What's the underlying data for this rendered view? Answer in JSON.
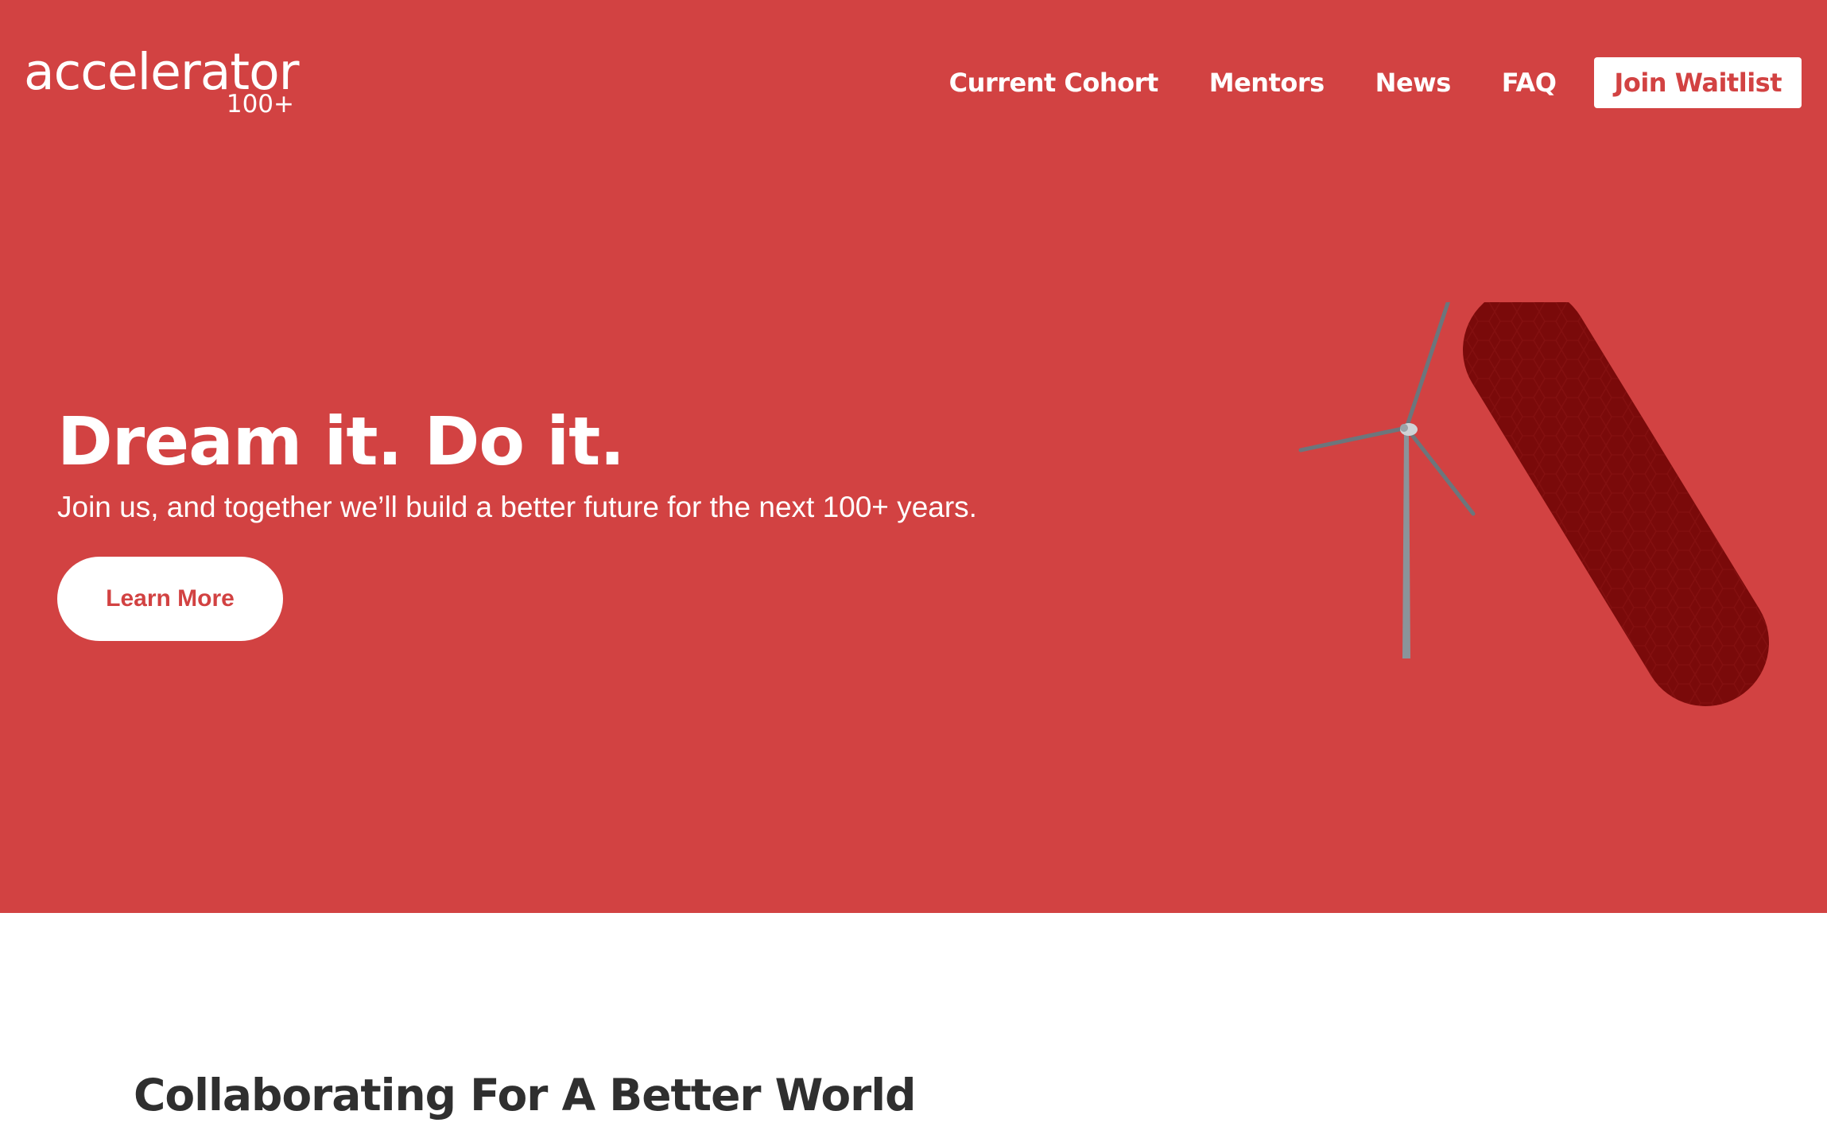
{
  "header": {
    "logo": {
      "main": "accelerator",
      "sub": "100+"
    },
    "nav": [
      {
        "label": "Current Cohort"
      },
      {
        "label": "Mentors"
      },
      {
        "label": "News"
      },
      {
        "label": "FAQ"
      }
    ],
    "cta_label": "Join Waitlist"
  },
  "hero": {
    "title": "Dream it. Do it.",
    "subtitle": "Join us, and together we’ll build a better future for the next 100+ years.",
    "button_label": "Learn More",
    "graphic": "wind-turbine-a-logo-image"
  },
  "section": {
    "title": "Collaborating For A Better World"
  },
  "colors": {
    "brand_red": "#d24242",
    "dark_red": "#7a0a0a",
    "white": "#ffffff",
    "text_dark": "#2f2f2f"
  }
}
